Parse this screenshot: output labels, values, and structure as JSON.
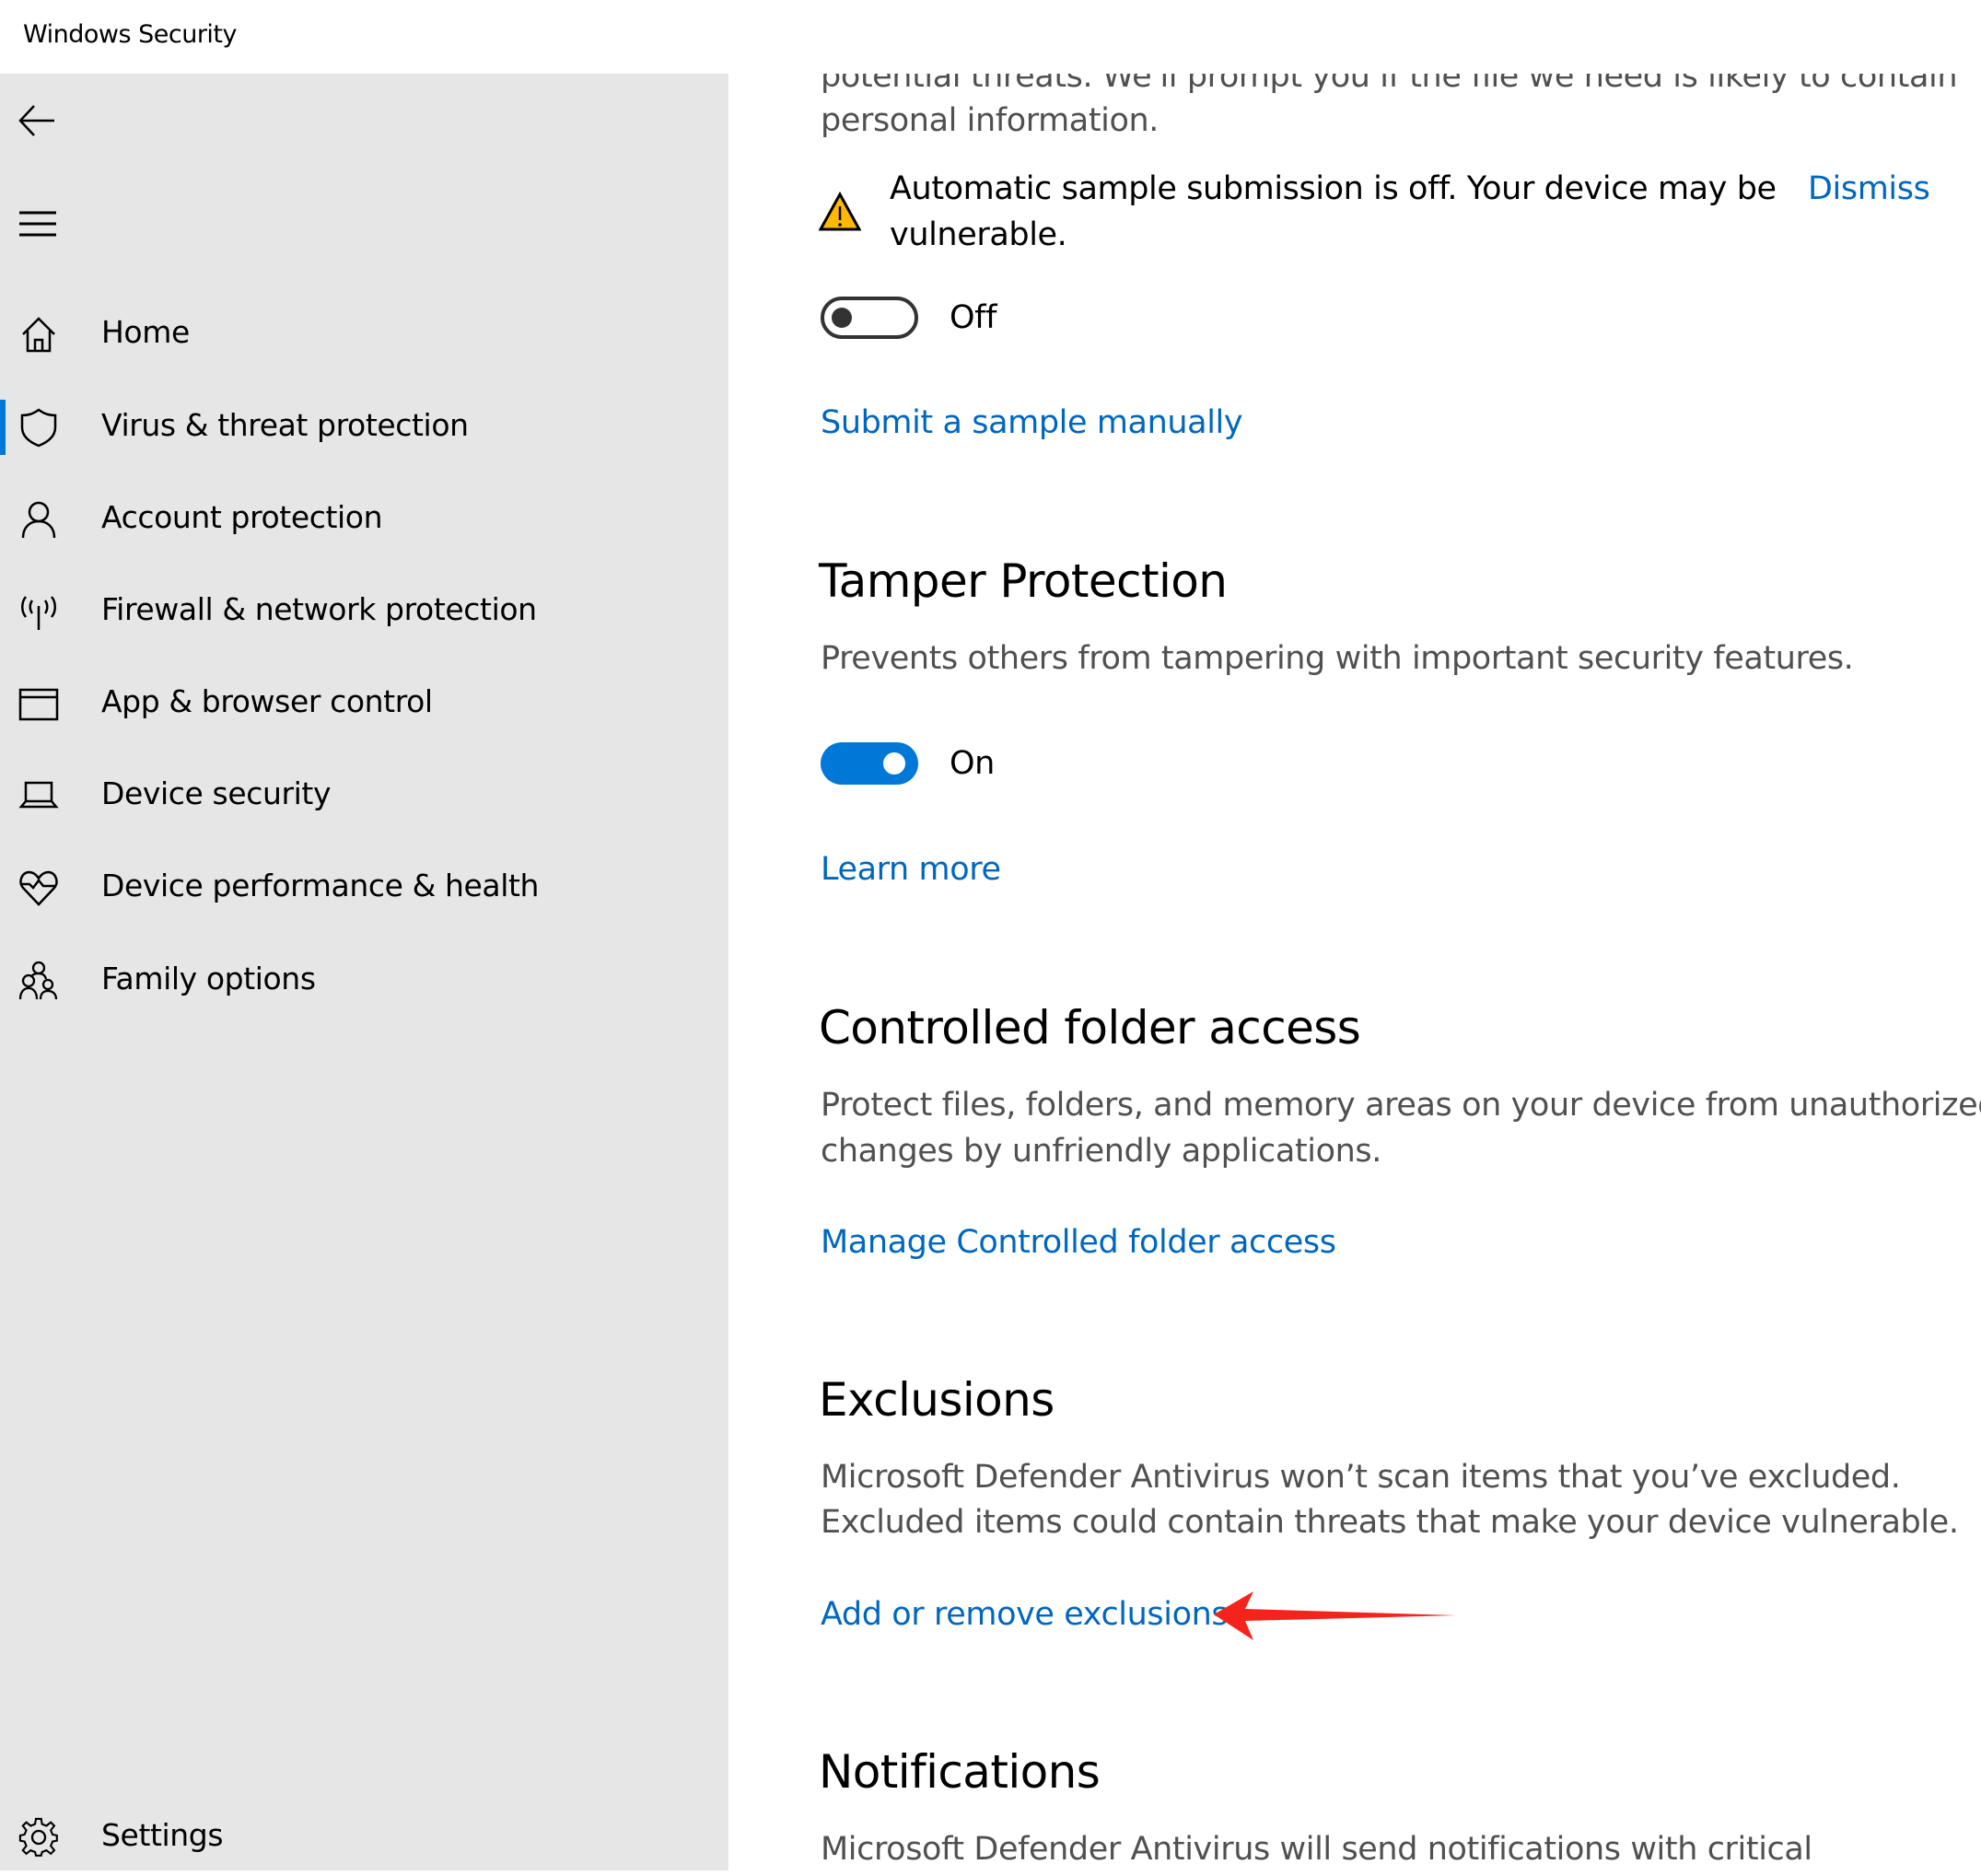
{
  "window": {
    "title": "Windows Security"
  },
  "sidebar": {
    "back_label": "Back",
    "menu_label": "Menu",
    "items": [
      {
        "label": "Home",
        "icon": "home-icon",
        "active": false
      },
      {
        "label": "Virus & threat protection",
        "icon": "shield-icon",
        "active": true
      },
      {
        "label": "Account protection",
        "icon": "person-icon",
        "active": false
      },
      {
        "label": "Firewall & network protection",
        "icon": "antenna-icon",
        "active": false
      },
      {
        "label": "App & browser control",
        "icon": "browser-window-icon",
        "active": false
      },
      {
        "label": "Device security",
        "icon": "laptop-icon",
        "active": false
      },
      {
        "label": "Device performance & health",
        "icon": "heart-pulse-icon",
        "active": false
      },
      {
        "label": "Family options",
        "icon": "family-icon",
        "active": false
      }
    ],
    "settings": {
      "label": "Settings",
      "icon": "gear-icon"
    }
  },
  "main": {
    "sample_submission": {
      "desc_line_cut": "potential threats. We'll prompt you if the file we need is likely to contain",
      "desc_line_last": "personal information.",
      "warning_line1": "Automatic sample submission is off. Your device may be",
      "warning_line2": "vulnerable.",
      "dismiss": "Dismiss",
      "toggle_state": "Off",
      "toggle_on": false,
      "link": "Submit a sample manually"
    },
    "tamper": {
      "title": "Tamper Protection",
      "desc": "Prevents others from tampering with important security features.",
      "toggle_state": "On",
      "toggle_on": true,
      "link": "Learn more"
    },
    "controlled_folder": {
      "title": "Controlled folder access",
      "desc_line1": "Protect files, folders, and memory areas on your device from unauthorized",
      "desc_line2": "changes by unfriendly applications.",
      "link": "Manage Controlled folder access"
    },
    "exclusions": {
      "title": "Exclusions",
      "desc_line1": "Microsoft Defender Antivirus won’t scan items that you’ve excluded.",
      "desc_line2": "Excluded items could contain threats that make your device vulnerable.",
      "link": "Add or remove exclusions"
    },
    "notifications": {
      "title": "Notifications",
      "desc_line1": "Microsoft Defender Antivirus will send notifications with critical"
    }
  },
  "colors": {
    "accent": "#0078d7",
    "link": "#0067c0",
    "sidebar_bg": "#e6e6e6",
    "warning": "#ffb900",
    "annotation_arrow": "#f5231b"
  }
}
